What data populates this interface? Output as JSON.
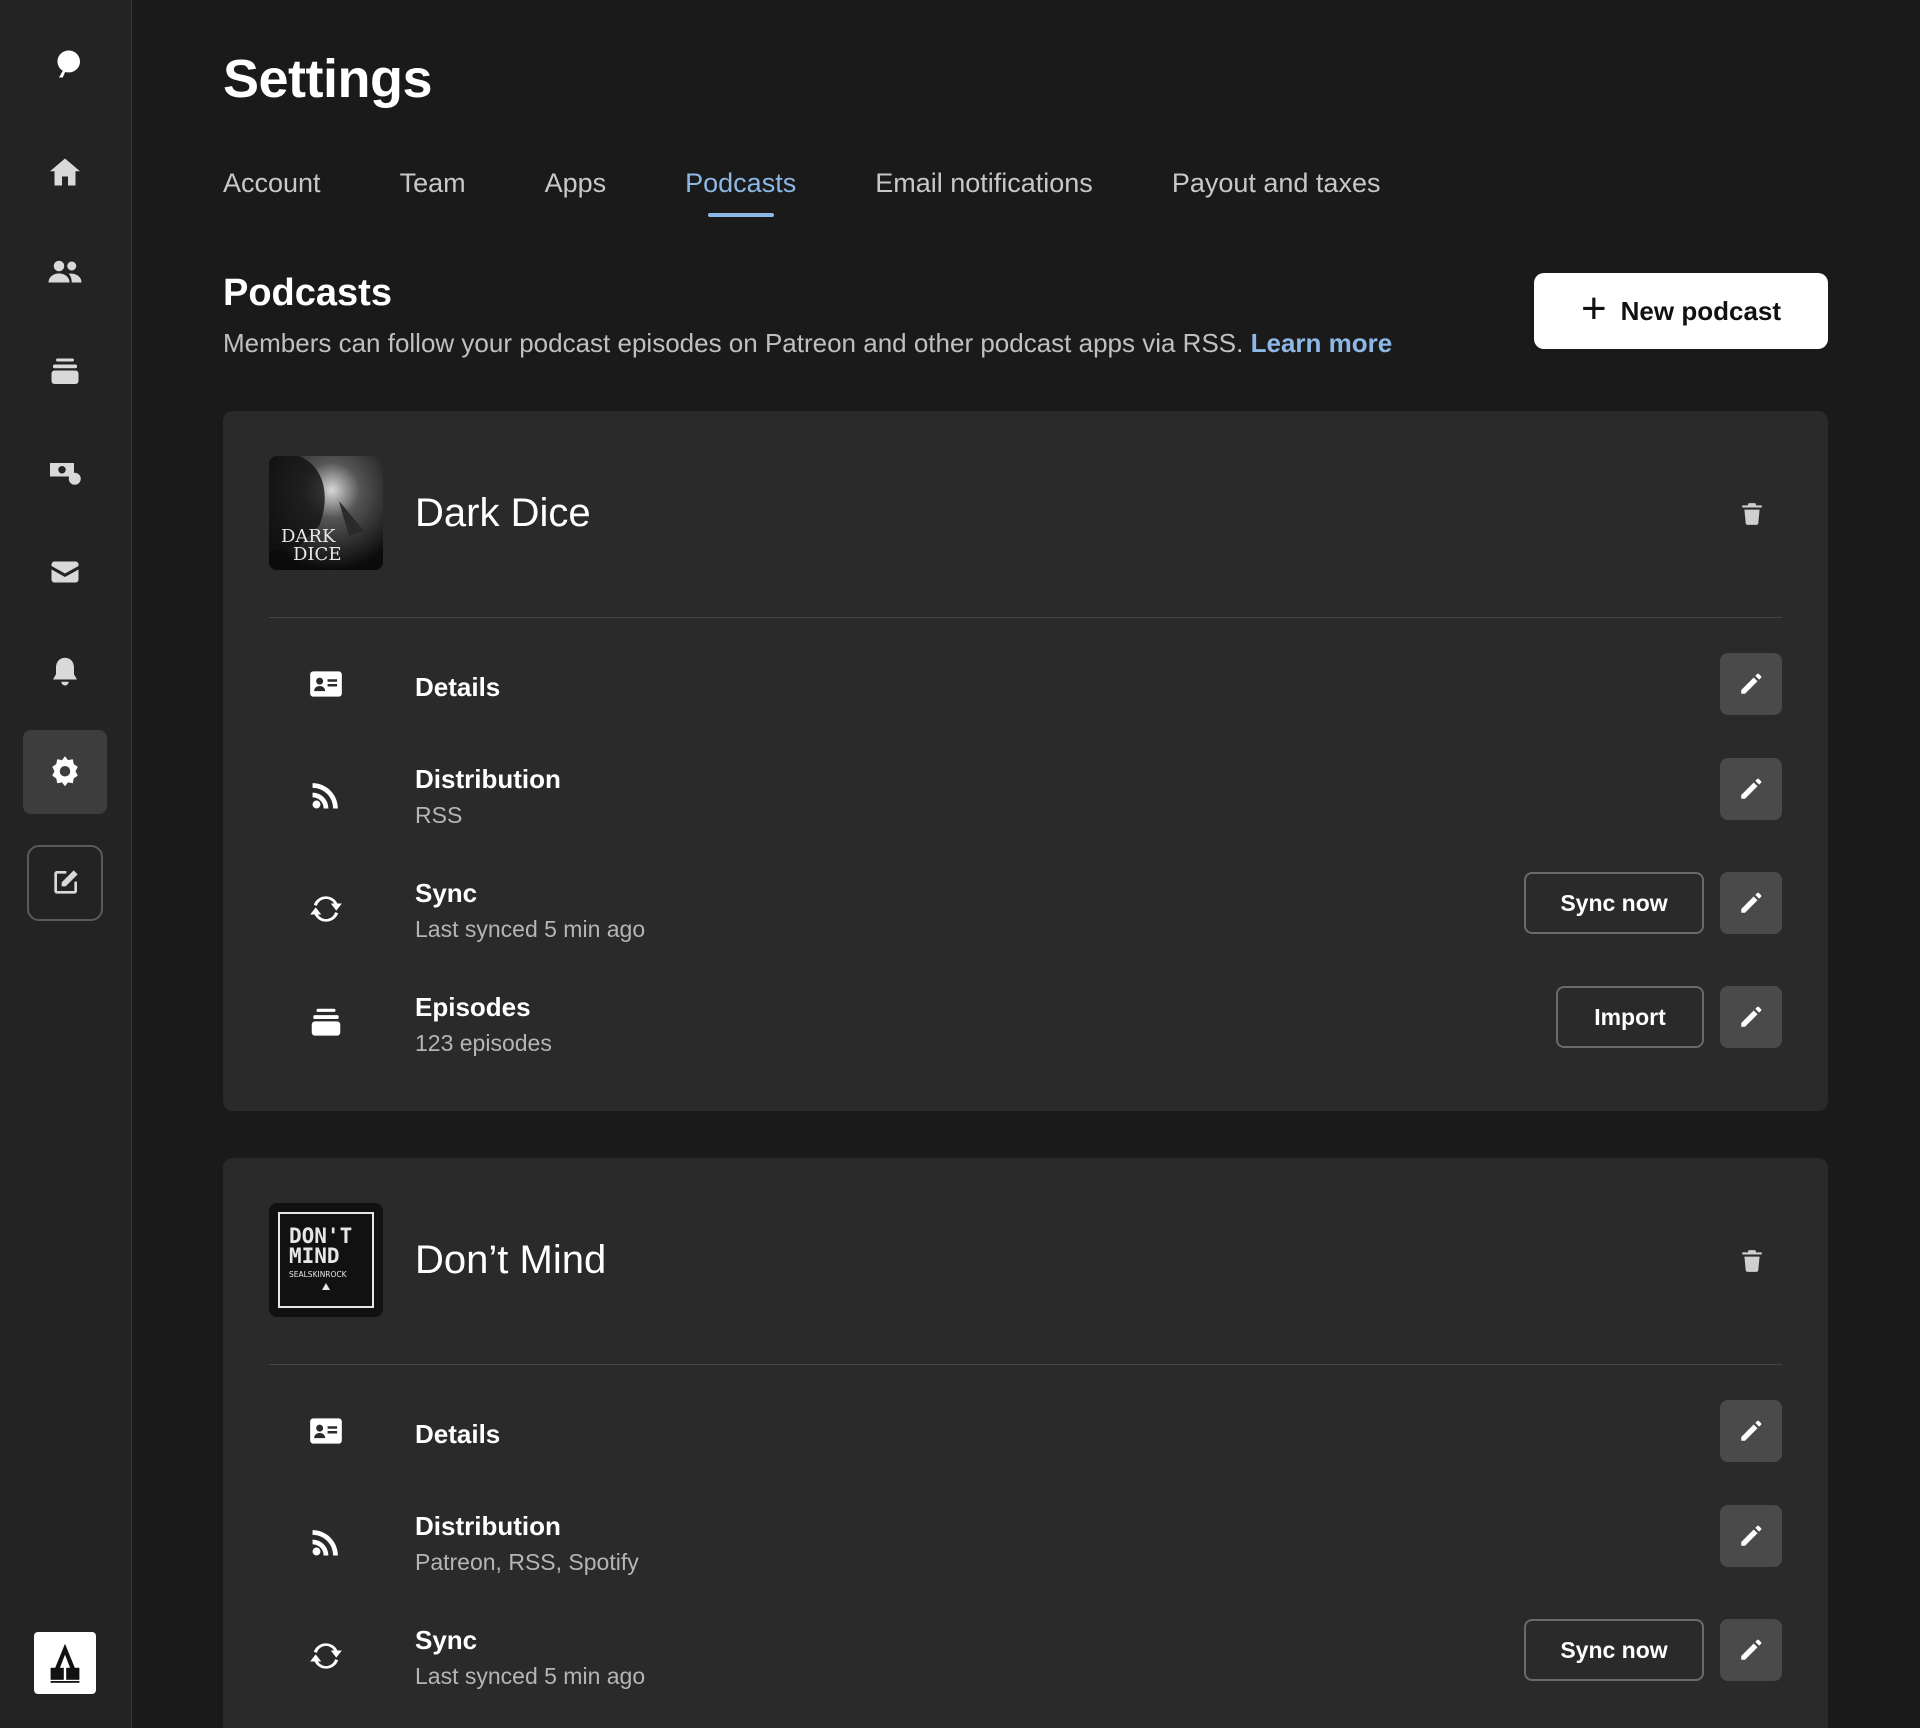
{
  "page": {
    "title": "Settings"
  },
  "tabs": [
    {
      "label": "Account"
    },
    {
      "label": "Team"
    },
    {
      "label": "Apps"
    },
    {
      "label": "Podcasts",
      "active": true
    },
    {
      "label": "Email notifications"
    },
    {
      "label": "Payout and taxes"
    }
  ],
  "section": {
    "title": "Podcasts",
    "description": "Members can follow your podcast episodes on Patreon and other podcast apps via RSS.",
    "learn_more": "Learn more",
    "new_button": "New podcast"
  },
  "podcasts": [
    {
      "name": "Dark Dice",
      "cover_text_line1": "DARK",
      "cover_text_line2": "DICE",
      "rows": {
        "details": {
          "title": "Details"
        },
        "distribution": {
          "title": "Distribution",
          "sub": "RSS"
        },
        "sync": {
          "title": "Sync",
          "sub": "Last synced 5 min ago",
          "action": "Sync now"
        },
        "episodes": {
          "title": "Episodes",
          "sub": "123 episodes",
          "action": "Import"
        }
      }
    },
    {
      "name": "Don’t Mind",
      "cover_text_line1": "DON'T",
      "cover_text_line2": "MIND",
      "cover_text_line3": "SEALSKINROCK",
      "rows": {
        "details": {
          "title": "Details"
        },
        "distribution": {
          "title": "Distribution",
          "sub": "Patreon, RSS, Spotify"
        },
        "sync": {
          "title": "Sync",
          "sub": "Last synced 5 min ago",
          "action": "Sync now"
        }
      }
    }
  ],
  "colors": {
    "accent": "#8db8e6",
    "background": "#1a1a1a",
    "card": "#2a2a2a",
    "sidebar": "#232323"
  }
}
